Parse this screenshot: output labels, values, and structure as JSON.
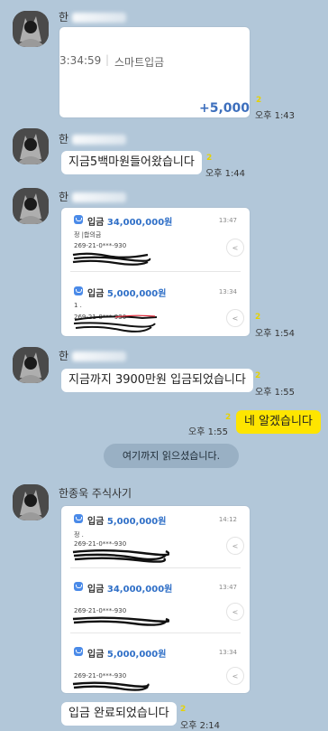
{
  "chat": {
    "messages": [
      {
        "sender_name": "한",
        "card_time": "3:34:59",
        "card_divider": "|",
        "card_label": "스마트입금",
        "card_amount": "+5,000",
        "unread": "2",
        "time": "오후 1:43"
      },
      {
        "sender_name": "한",
        "text": "지금5백마원들어왔습니다",
        "unread": "2",
        "time": "오후 1:44"
      },
      {
        "sender_name": "한",
        "transactions": [
          {
            "label": "입금",
            "amount": "34,000,000원",
            "time": "13:47",
            "line1": "정    |합의금",
            "account": "269-21-0***-930"
          },
          {
            "label": "입금",
            "amount": "5,000,000원",
            "time": "13:34",
            "line1": "1 .",
            "account": "269-21-0***-930"
          }
        ],
        "unread": "2",
        "time": "오후 1:54"
      },
      {
        "sender_name": "한",
        "text": "지금까지 3900만원 입금되었습니다",
        "unread": "2",
        "time": "오후 1:55"
      },
      {
        "mine": true,
        "text": "네 알겠습니다",
        "unread": "2",
        "time": "오후 1:55"
      },
      {
        "sender_name": "한종욱 주식사기",
        "transactions": [
          {
            "label": "입금",
            "amount": "5,000,000원",
            "time": "14:12",
            "line1": "정 .",
            "account": "269-21-0***-930"
          },
          {
            "label": "입금",
            "amount": "34,000,000원",
            "time": "13:47",
            "line1": "",
            "account": "269-21-0***-930"
          },
          {
            "label": "입금",
            "amount": "5,000,000원",
            "time": "13:34",
            "line1": "",
            "account": "269-21-0***-930"
          }
        ]
      },
      {
        "text": "입금 완료되었습니다",
        "unread": "2",
        "time": "오후 2:14"
      }
    ],
    "read_notice": "여기까지 읽으셨습니다.",
    "share_icon": "share-icon",
    "bank_icon": "bank-icon",
    "colors": {
      "background": "#b2c7d9",
      "my_bubble": "#fee500",
      "amount_blue": "#2f6fc7",
      "unread_yellow": "#e6d200"
    }
  }
}
